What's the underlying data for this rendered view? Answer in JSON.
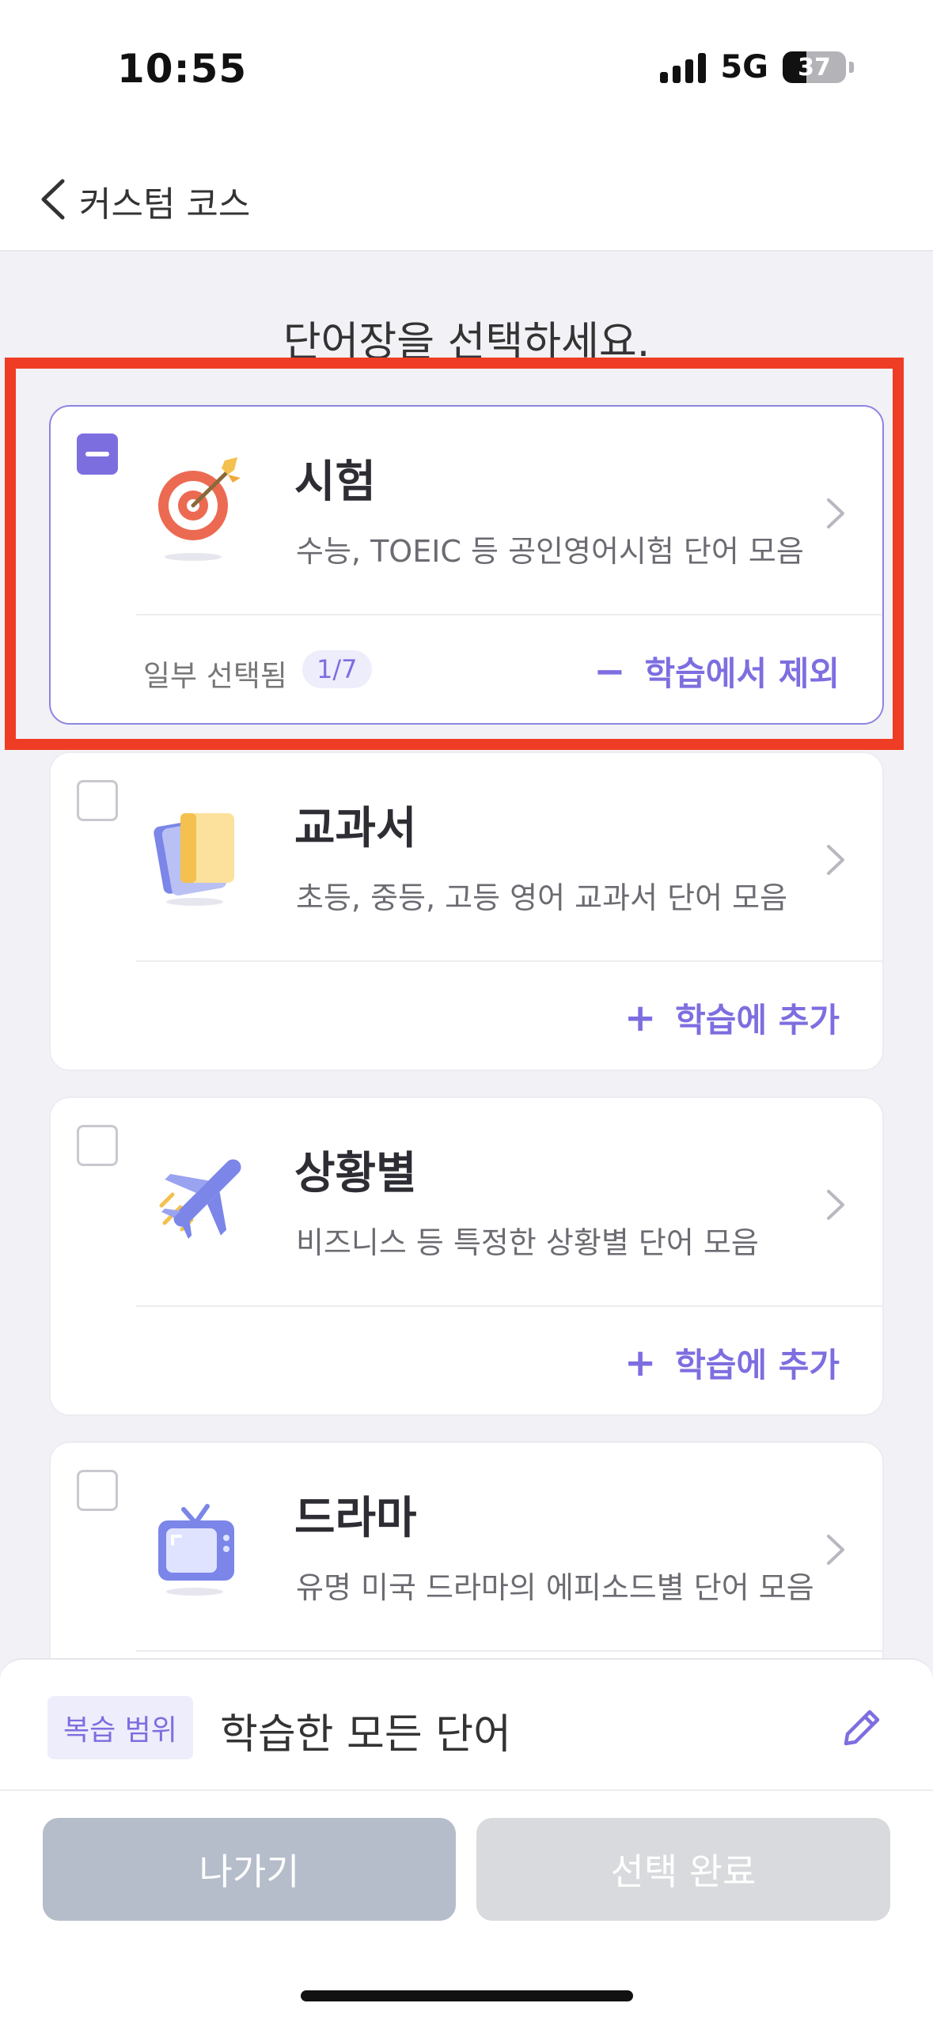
{
  "status": {
    "time": "10:55",
    "network": "5G",
    "battery": "37",
    "battery_level": 0.37
  },
  "header": {
    "title": "커스텀 코스"
  },
  "prompt": "단어장을 선택하세요.",
  "cards": [
    {
      "title": "시험",
      "desc": "수능, TOEIC 등 공인영어시험 단어 모음",
      "state": "partial",
      "partial_label": "일부 선택됨",
      "count": "1/7",
      "action_symbol": "−",
      "action": "학습에서 제외",
      "icon": "target-icon"
    },
    {
      "title": "교과서",
      "desc": "초등, 중등, 고등 영어 교과서 단어 모음",
      "state": "none",
      "action_symbol": "+",
      "action": "학습에 추가",
      "icon": "book-icon"
    },
    {
      "title": "상황별",
      "desc": "비즈니스 등 특정한 상황별 단어 모음",
      "state": "none",
      "action_symbol": "+",
      "action": "학습에 추가",
      "icon": "airplane-icon"
    },
    {
      "title": "드라마",
      "desc": "유명 미국 드라마의 에피소드별 단어 모음",
      "state": "none",
      "icon": "tv-icon"
    }
  ],
  "review": {
    "tag": "복습 범위",
    "value": "학습한 모든 단어"
  },
  "buttons": {
    "exit": "나가기",
    "done": "선택 완료"
  },
  "colors": {
    "accent": "#7d6ee0",
    "highlight": "#ee3d24"
  }
}
